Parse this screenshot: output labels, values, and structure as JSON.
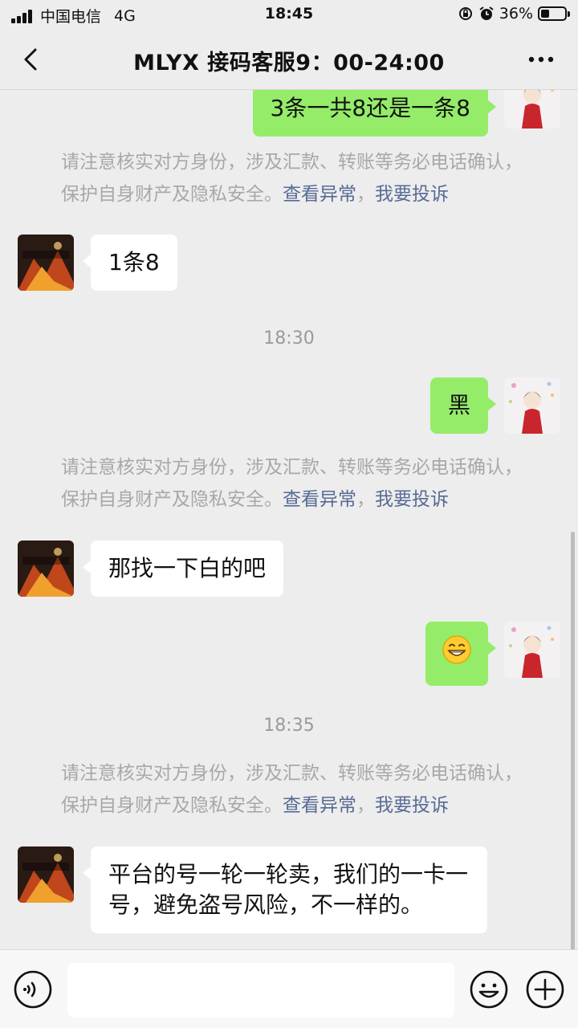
{
  "status_bar": {
    "carrier": "中国电信",
    "network": "4G",
    "time": "18:45",
    "battery": "36%",
    "battery_level": 0.36
  },
  "header": {
    "title": "MLYX 接码客服9：00-24:00"
  },
  "notice": {
    "text": "请注意核实对方身份，涉及汇款、转账等务必电话确认，保护自身财产及隐私安全。",
    "link_abnormal": "查看异常",
    "separator": "，",
    "link_complain": "我要投诉"
  },
  "messages": [
    {
      "side": "me",
      "text": "3条一共8还是一条8"
    },
    {
      "side": "them",
      "text": "1条8"
    },
    {
      "time": "18:30"
    },
    {
      "side": "me",
      "text": "黑"
    },
    {
      "side": "them",
      "text": "那找一下白的吧"
    },
    {
      "side": "me",
      "emoji": "grinning-face"
    },
    {
      "time": "18:35"
    },
    {
      "side": "them",
      "text": "平台的号一轮一轮卖，我们的一卡一号，避免盗号风险，不一样的。"
    }
  ],
  "colors": {
    "background": "#ededed",
    "bubble_me": "#95ec69",
    "bubble_them": "#ffffff",
    "link": "#576b95"
  }
}
